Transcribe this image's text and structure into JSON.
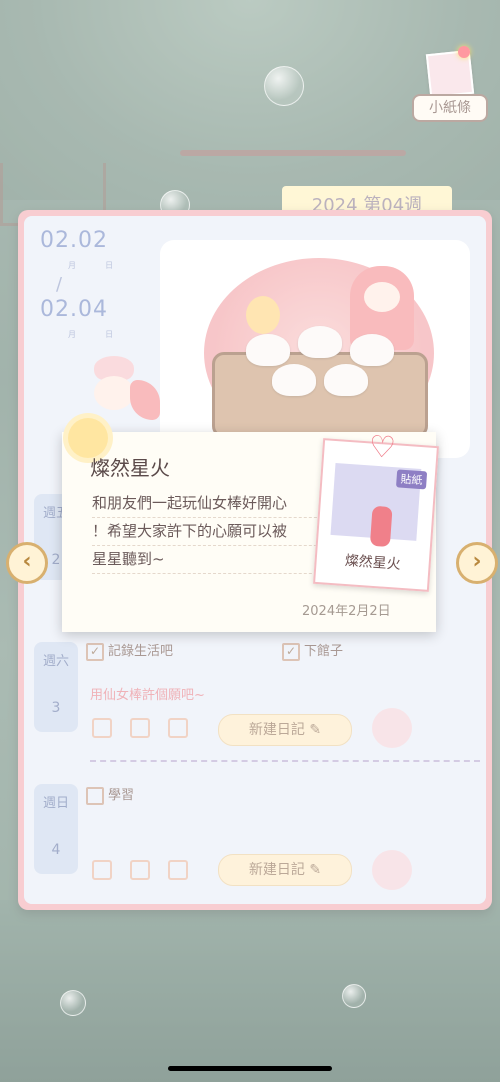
{
  "note_button": {
    "label": "小紙條"
  },
  "diary": {
    "week_label": "2024 第04週",
    "date_start": {
      "value": "02.02",
      "month_char": "月",
      "day_char": "日"
    },
    "date_end": {
      "value": "02.04",
      "month_char": "月",
      "day_char": "日"
    },
    "date_separator": "/",
    "days": [
      {
        "day": "週五",
        "number": "2"
      },
      {
        "day": "週六",
        "number": "3",
        "todos": [
          {
            "label": "記錄生活吧",
            "checked": true
          },
          {
            "label": "下館子",
            "checked": true
          }
        ],
        "note": "用仙女棒許個願吧~",
        "button": "新建日記"
      },
      {
        "day": "週日",
        "number": "4",
        "todos": [
          {
            "label": "學習",
            "checked": false
          }
        ],
        "button": "新建日記"
      }
    ]
  },
  "nav": {
    "prev_icon": "‹",
    "next_icon": "›"
  },
  "popup": {
    "title": "燦然星火",
    "body_lines": [
      "和朋友們一起玩仙女棒好開心",
      "！希望大家許下的心願可以被",
      "星星聽到~"
    ],
    "date": "2024年2月2日",
    "sticker": {
      "tag": "貼紙",
      "name": "燦然星火"
    }
  },
  "colors": {
    "accent_pink": "#f3a9b0",
    "blue_text": "#6e85c2",
    "popup_bg": "#fffdf6"
  }
}
